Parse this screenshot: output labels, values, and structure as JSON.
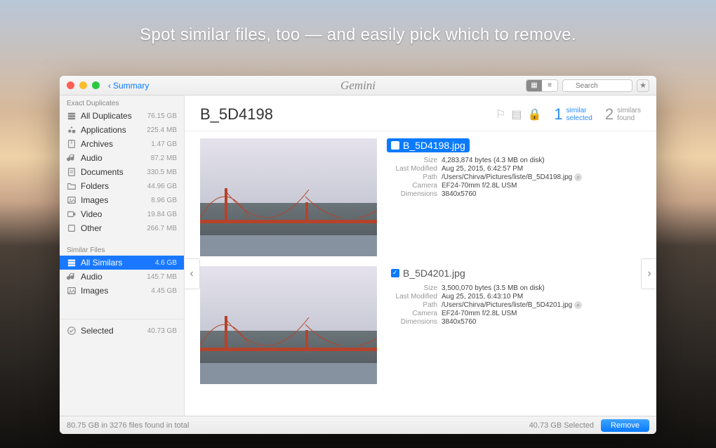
{
  "headline": "Spot similar files, too — and easily pick which to remove.",
  "titlebar": {
    "back_label": "Summary",
    "app_title": "Gemini",
    "search_placeholder": "Search"
  },
  "sidebar": {
    "section1_title": "Exact Duplicates",
    "section2_title": "Similar Files",
    "items1": [
      {
        "icon": "stack",
        "label": "All Duplicates",
        "size": "76.15 GB"
      },
      {
        "icon": "app",
        "label": "Applications",
        "size": "225.4 MB"
      },
      {
        "icon": "archive",
        "label": "Archives",
        "size": "1.47 GB"
      },
      {
        "icon": "audio",
        "label": "Audio",
        "size": "87.2 MB"
      },
      {
        "icon": "doc",
        "label": "Documents",
        "size": "330.5 MB"
      },
      {
        "icon": "folder",
        "label": "Folders",
        "size": "44.96 GB"
      },
      {
        "icon": "image",
        "label": "Images",
        "size": "8.96 GB"
      },
      {
        "icon": "video",
        "label": "Video",
        "size": "19.84 GB"
      },
      {
        "icon": "other",
        "label": "Other",
        "size": "266.7 MB"
      }
    ],
    "items2": [
      {
        "icon": "stack",
        "label": "All Similars",
        "size": "4.6 GB"
      },
      {
        "icon": "audio",
        "label": "Audio",
        "size": "145.7 MB"
      },
      {
        "icon": "image",
        "label": "Images",
        "size": "4.45 GB"
      }
    ],
    "selected_label": "Selected",
    "selected_size": "40.73 GB"
  },
  "header": {
    "title": "B_5D4198",
    "count1_num": "1",
    "count1_l1": "similar",
    "count1_l2": "selected",
    "count2_num": "2",
    "count2_l1": "similars",
    "count2_l2": "found"
  },
  "files": [
    {
      "name": "B_5D4198.jpg",
      "selected": true,
      "checked": false,
      "meta": {
        "size": "4,283,874 bytes (4.3 MB on disk)",
        "modified": "Aug 25, 2015, 6:42:57 PM",
        "path": "/Users/Chirva/Pictures/liste/B_5D4198.jpg",
        "camera": "EF24-70mm f/2.8L USM",
        "dimensions": "3840x5760"
      }
    },
    {
      "name": "B_5D4201.jpg",
      "selected": false,
      "checked": true,
      "meta": {
        "size": "3,500,070 bytes (3.5 MB on disk)",
        "modified": "Aug 25, 2015, 6:43:10 PM",
        "path": "/Users/Chirva/Pictures/liste/B_5D4201.jpg",
        "camera": "EF24-70mm f/2.8L USM",
        "dimensions": "3840x5760"
      }
    }
  ],
  "meta_labels": {
    "size": "Size",
    "modified": "Last Modified",
    "path": "Path",
    "camera": "Camera",
    "dimensions": "Dimensions"
  },
  "footer": {
    "left": "80.75 GB in 3276 files found in total",
    "selected": "40.73 GB Selected",
    "remove": "Remove"
  }
}
